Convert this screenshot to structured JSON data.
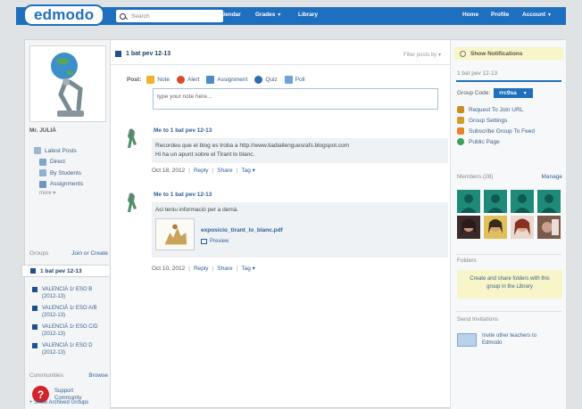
{
  "nav": {
    "logo": "edmodo",
    "search_placeholder": "Search",
    "calendar": "Calendar",
    "grades": "Grades",
    "library": "Library",
    "home": "Home",
    "profile": "Profile",
    "account": "Account"
  },
  "sidebar": {
    "user_name": "Mr. JULIÀ",
    "nav": [
      {
        "label": "Latest Posts"
      },
      {
        "label": "Direct"
      },
      {
        "label": "By Students"
      },
      {
        "label": "Assignments"
      }
    ],
    "more": "more",
    "groups_label": "Groups",
    "join_create": "Join or Create",
    "active_group": "1 bat pev 12-13",
    "groups": [
      {
        "label": "VALENCIÀ 1r ESO B (2012-13)"
      },
      {
        "label": "VALENCIÀ 1r ESO A/B (2012-13)"
      },
      {
        "label": "VALENCIÀ 1r ESO C/D (2012-13)"
      },
      {
        "label": "VALENCIÀ 1r ESO D (2012-13)"
      }
    ],
    "communities_label": "Communities",
    "browse": "Browse",
    "support": "Support Community",
    "archived": "+ Show Archived Groups"
  },
  "main": {
    "title": "1 bat pev 12-13",
    "filter": "Filter posts by",
    "post_label": "Post:",
    "post_types": [
      {
        "label": "Note",
        "color": "#f2b22e"
      },
      {
        "label": "Alert",
        "color": "#d94a2a"
      },
      {
        "label": "Assignment",
        "color": "#4d8bc6"
      },
      {
        "label": "Quiz",
        "color": "#2f6db0"
      },
      {
        "label": "Poll",
        "color": "#6ba4d8"
      }
    ],
    "composer_placeholder": "type your note here...",
    "posts": [
      {
        "who": "Me to 1 bat pev 12-13",
        "lines": [
          "Recordeu que el blog es troba a http://www.tiadiallenguesrafs.blogspot.com",
          "Hi ha un apunt sobre el Tirant lo blanc."
        ],
        "date": "Oct 18, 2012",
        "reply": "Reply",
        "share": "Share",
        "tag": "Tag"
      },
      {
        "who": "Me to 1 bat pev 12-13",
        "lines": [
          "Aci teniu informació per a demà."
        ],
        "attachment": "exposicio_tirant_lo_blanc.pdf",
        "preview": "Preview",
        "date": "Oct 10, 2012",
        "reply": "Reply",
        "share": "Share",
        "tag": "Tag"
      }
    ]
  },
  "right": {
    "notifications": "Show Notifications",
    "group_title": "1 bat pev 12-13",
    "group_code_label": "Group Code:",
    "group_code": "rrc9sa",
    "actions": [
      {
        "label": "Request To Join URL",
        "color": "#c88c2a"
      },
      {
        "label": "Group Settings",
        "color": "#d49a2a"
      },
      {
        "label": "Subscribe Group To Feed",
        "color": "#e9832a"
      },
      {
        "label": "Public Page",
        "color": "#3ca05a"
      }
    ],
    "members_label": "Members (28)",
    "manage": "Manage",
    "folders_label": "Folders",
    "folders_text": "Create and share folders with this group in the Library",
    "send_invitations": "Send Invitations",
    "invite_text": "Invite other teachers to Edmodo"
  },
  "colors": {
    "brand": "#1f6fbf",
    "dark_blue": "#1f4f8f"
  }
}
